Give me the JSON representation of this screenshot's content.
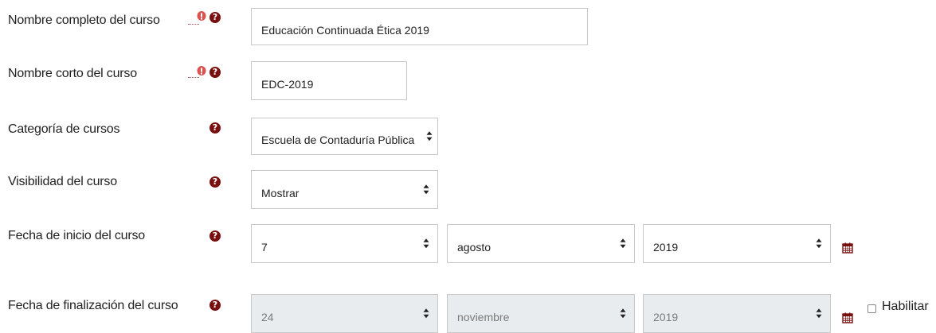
{
  "fields": {
    "fullname": {
      "label": "Nombre completo del curso",
      "value": "Educación Continuada Ética 2019"
    },
    "shortname": {
      "label": "Nombre corto del curso",
      "value": "EDC-2019"
    },
    "category": {
      "label": "Categoría de cursos",
      "value": "Escuela de Contaduría Pública"
    },
    "visibility": {
      "label": "Visibilidad del curso",
      "value": "Mostrar"
    },
    "startdate": {
      "label": "Fecha de inicio del curso",
      "day": "7",
      "month": "agosto",
      "year": "2019"
    },
    "enddate": {
      "label": "Fecha de finalización del curso",
      "day": "24",
      "month": "noviembre",
      "year": "2019",
      "enable_label": "Habilitar"
    }
  },
  "icons": {
    "required": "exclamation-circle-icon",
    "help": "question-circle-icon",
    "calendar": "calendar-icon"
  },
  "colors": {
    "required": "#d9534f",
    "help": "#7a0f0f",
    "calendar": "#7a0f0f",
    "disabled_bg": "#e9ecef"
  }
}
